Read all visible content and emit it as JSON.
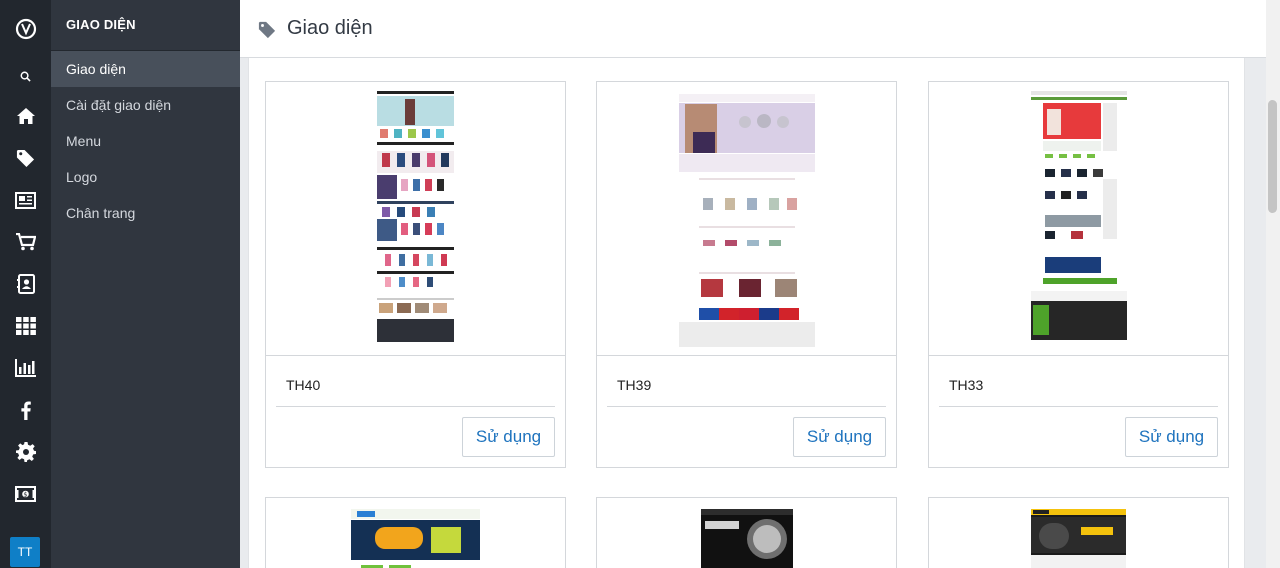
{
  "rail": {
    "icons": [
      "logo-icon",
      "search-icon",
      "home-icon",
      "tag-icon",
      "newspaper-icon",
      "cart-icon",
      "contacts-icon",
      "apps-icon",
      "chart-icon",
      "facebook-icon",
      "settings-icon",
      "money-icon"
    ],
    "avatar": "TT"
  },
  "subsidebar": {
    "title": "GIAO DIỆN",
    "items": [
      {
        "label": "Giao diện",
        "active": true
      },
      {
        "label": "Cài đặt giao diện"
      },
      {
        "label": "Menu"
      },
      {
        "label": "Logo"
      },
      {
        "label": "Chân trang"
      }
    ]
  },
  "header": {
    "title": "Giao diện"
  },
  "themes": [
    {
      "name": "TH40",
      "button": "Sử dụng"
    },
    {
      "name": "TH39",
      "button": "Sử dụng"
    },
    {
      "name": "TH33",
      "button": "Sử dụng"
    }
  ],
  "colors": {
    "rail_bg": "#22272e",
    "sidebar_bg": "#30363f",
    "sidebar_active": "#48505b",
    "accent": "#1e73be",
    "avatar": "#0f7fc7"
  }
}
